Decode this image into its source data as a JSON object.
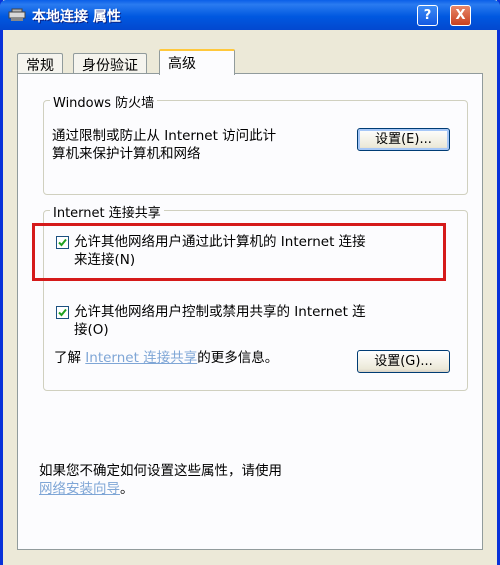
{
  "window": {
    "title": "本地连接 属性",
    "help_button": "?",
    "close_button": "X"
  },
  "tabs": [
    {
      "label": "常规",
      "active": false
    },
    {
      "label": "身份验证",
      "active": false
    },
    {
      "label": "高级",
      "active": true
    }
  ],
  "firewall": {
    "group_title": "Windows 防火墙",
    "description_line1": "通过限制或防止从 Internet 访问此计",
    "description_line2": "算机来保护计算机和网络",
    "settings_button": "设置(E)..."
  },
  "ics": {
    "group_title": "Internet 连接共享",
    "allow_connect": {
      "checked": true,
      "line1": "允许其他网络用户通过此计算机的 Internet 连接",
      "line2": "来连接(N)"
    },
    "allow_control": {
      "checked": true,
      "line1": "允许其他网络用户控制或禁用共享的 Internet 连",
      "line2": "接(O)"
    },
    "learn_prefix": "了解",
    "learn_link": "Internet 连接共享",
    "learn_suffix": "的更多信息。",
    "settings_button": "设置(G)..."
  },
  "footer": {
    "text": "如果您不确定如何设置这些属性，请使用",
    "link": "网络安装向导",
    "link_suffix": "。"
  },
  "colors": {
    "titlebar": "#0058e0",
    "highlight_box": "#d51a1a",
    "link": "#7fa6d6",
    "active_tab_accent": "#ffc83c"
  }
}
